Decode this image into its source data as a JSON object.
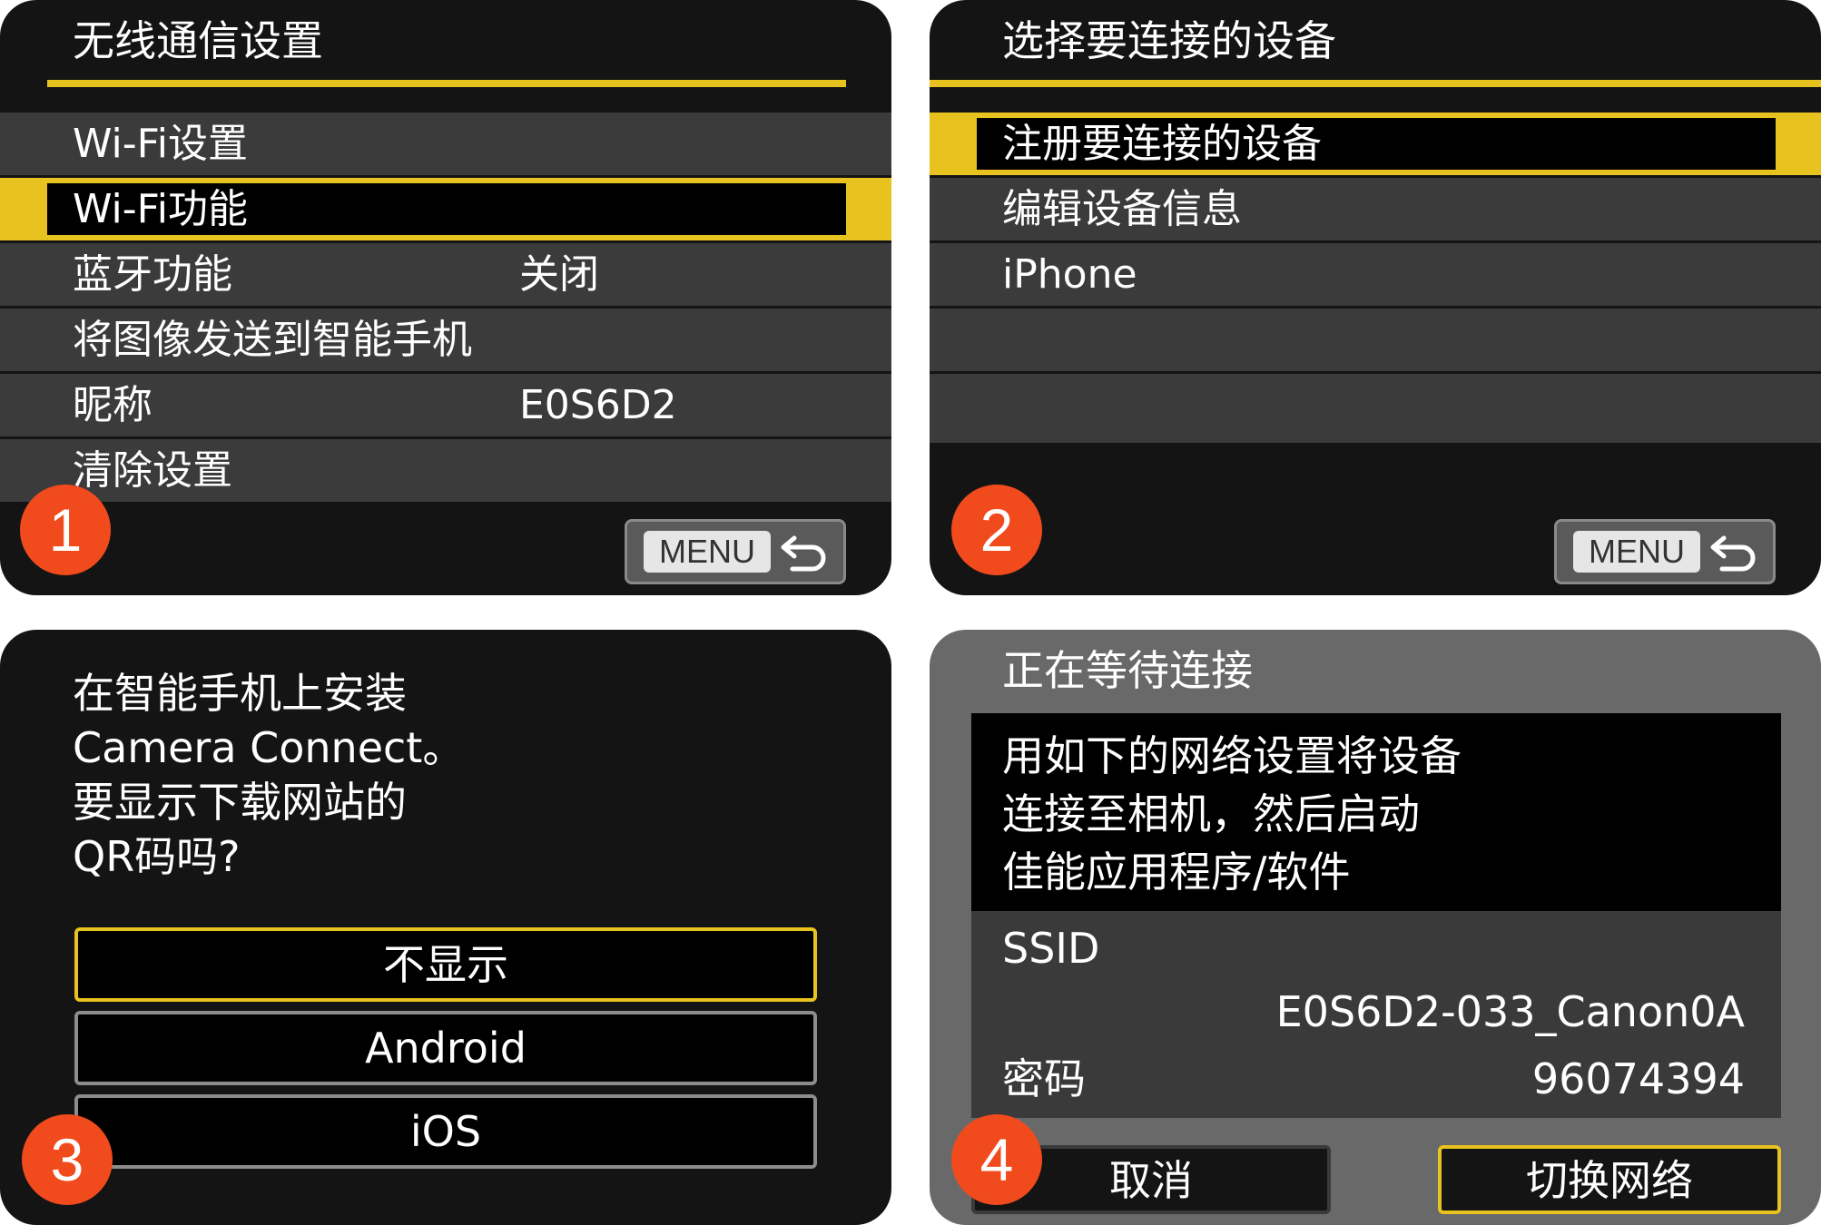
{
  "panel1": {
    "title": "无线通信设置",
    "rows": [
      {
        "label": "Wi-Fi设置",
        "value": ""
      },
      {
        "label": "Wi-Fi功能",
        "value": ""
      },
      {
        "label": "蓝牙功能",
        "value": "关闭"
      },
      {
        "label": "将图像发送到智能手机",
        "value": ""
      },
      {
        "label": "昵称",
        "value": "E0S6D2"
      },
      {
        "label": "清除设置",
        "value": ""
      }
    ],
    "selected_index": 1,
    "menu_label": "MENU",
    "step": "1"
  },
  "panel2": {
    "title": "选择要连接的设备",
    "rows": [
      {
        "label": "注册要连接的设备"
      },
      {
        "label": "编辑设备信息"
      },
      {
        "label": "iPhone"
      },
      {
        "label": ""
      },
      {
        "label": ""
      }
    ],
    "selected_index": 0,
    "menu_label": "MENU",
    "step": "2"
  },
  "panel3": {
    "question_lines": [
      "在智能手机上安装",
      "Camera Connect。",
      "要显示下载网站的",
      "QR码吗?"
    ],
    "options": [
      "不显示",
      "Android",
      "iOS"
    ],
    "selected_index": 0,
    "step": "3"
  },
  "panel4": {
    "title": "正在等待连接",
    "message_lines": [
      "用如下的网络设置将设备",
      "连接至相机，然后启动",
      "佳能应用程序/软件"
    ],
    "ssid_label": "SSID",
    "ssid_value": "E0S6D2-033_Canon0A",
    "password_label": "密码",
    "password_value": "96074394",
    "cancel_label": "取消",
    "switch_label": "切换网络",
    "step": "4"
  },
  "colors": {
    "accent_yellow": "#e8c21f",
    "badge_orange": "#f14a1d",
    "panel_bg": "#141414",
    "row_bg": "#3b3b3b"
  }
}
